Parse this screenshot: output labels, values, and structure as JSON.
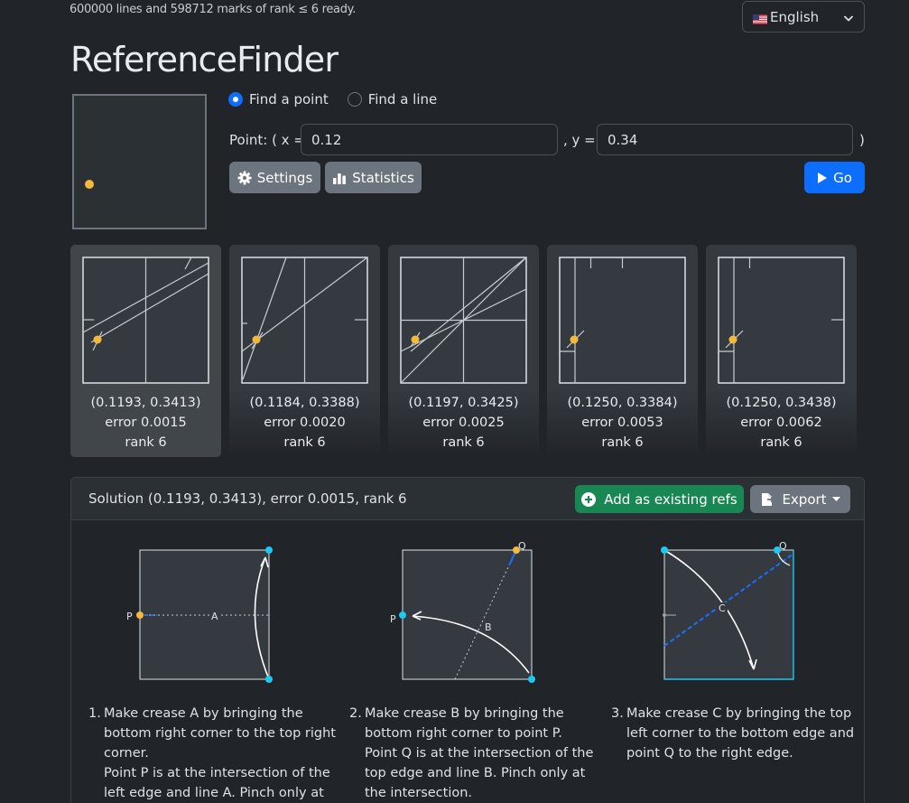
{
  "status": "600000 lines and 598712 marks of rank ≤ 6 ready.",
  "language": {
    "selected": "English"
  },
  "app_title": "ReferenceFinder",
  "mode": {
    "options": [
      {
        "label": "Find a point",
        "selected": true
      },
      {
        "label": "Find a line",
        "selected": false
      }
    ]
  },
  "point_input": {
    "prefix": "Point: ( x =",
    "x_value": "0.12",
    "mid": ", y =",
    "y_value": "0.34",
    "suffix": ")"
  },
  "buttons": {
    "settings": "Settings",
    "statistics": "Statistics",
    "go": "Go"
  },
  "results": [
    {
      "coords": "(0.1193, 0.3413)",
      "error": "error 0.0015",
      "rank": "rank 6"
    },
    {
      "coords": "(0.1184, 0.3388)",
      "error": "error 0.0020",
      "rank": "rank 6"
    },
    {
      "coords": "(0.1197, 0.3425)",
      "error": "error 0.0025",
      "rank": "rank 6"
    },
    {
      "coords": "(0.1250, 0.3384)",
      "error": "error 0.0053",
      "rank": "rank 6"
    },
    {
      "coords": "(0.1250, 0.3438)",
      "error": "error 0.0062",
      "rank": "rank 6"
    }
  ],
  "solution": {
    "title": "Solution (0.1193, 0.3413), error 0.0015, rank 6",
    "add_refs": "Add as existing refs",
    "export": "Export",
    "steps": [
      {
        "num": "1.",
        "lines": [
          "Make crease A by bringing the",
          "bottom right corner to the top right",
          "corner.",
          "Point P is at the intersection of the",
          "left edge and line A. Pinch only at"
        ],
        "labels": {
          "p": "P",
          "a": "A"
        }
      },
      {
        "num": "2.",
        "lines": [
          "Make crease B by bringing the",
          "bottom right corner to point P.",
          "Point Q is at the intersection of the",
          "top edge and line B. Pinch only at",
          "the intersection."
        ],
        "labels": {
          "p": "P",
          "q": "Q",
          "b": "B"
        }
      },
      {
        "num": "3.",
        "lines": [
          "Make crease C by bringing the top",
          "left corner to the bottom edge and",
          "point Q to the right edge."
        ],
        "labels": {
          "q": "Q",
          "c": "C"
        }
      }
    ]
  },
  "colors": {
    "background": "#212529",
    "accent_blue": "#0d6efd",
    "success_green": "#198754",
    "point_yellow": "#f5b83d",
    "marker_cyan": "#1ec8f0"
  }
}
